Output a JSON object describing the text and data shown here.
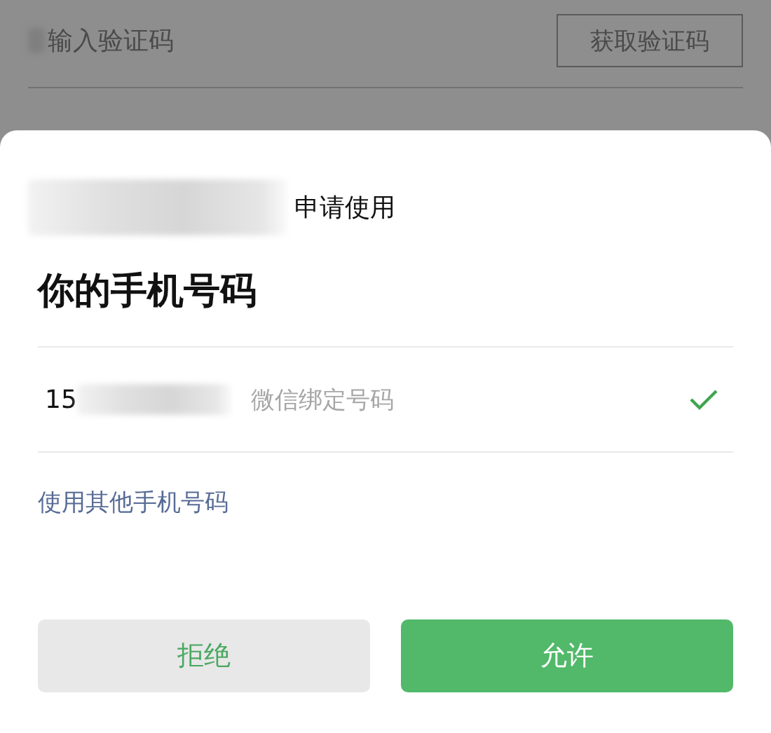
{
  "background_form": {
    "code_field": {
      "placeholder": "输入验证码"
    },
    "get_code_button": "获取验证码"
  },
  "sheet": {
    "request_text": "申请使用",
    "title": "你的手机号码",
    "phone_options": [
      {
        "number": "15",
        "note": "微信绑定号码",
        "selected": true
      }
    ],
    "other_number_link": "使用其他手机号码",
    "buttons": [
      {
        "label": "拒绝",
        "kind": "secondary"
      },
      {
        "label": "允许",
        "kind": "primary"
      }
    ]
  }
}
